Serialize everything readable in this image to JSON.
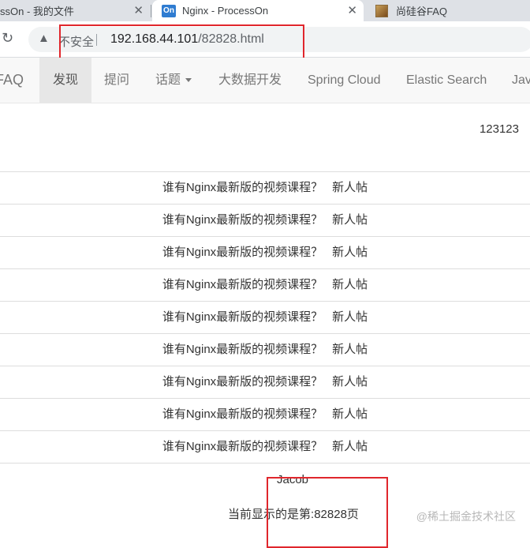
{
  "tabs": [
    {
      "title": "ssOn - 我的文件"
    },
    {
      "title": "Nginx - ProcessOn",
      "favicon_text": "On"
    },
    {
      "title": "尚硅谷FAQ"
    }
  ],
  "tab_close_glyph": "✕",
  "address_bar": {
    "security_label": "不安全",
    "url_host": "192.168.44.101",
    "url_path": "/82828.html"
  },
  "nav": {
    "brand": "FAQ",
    "items": [
      {
        "label": "发现"
      },
      {
        "label": "提问"
      },
      {
        "label": "话题"
      },
      {
        "label": "大数据开发"
      },
      {
        "label": "Spring Cloud"
      },
      {
        "label": "Elastic Search"
      },
      {
        "label": "Jav"
      }
    ]
  },
  "user": "123123",
  "posts": [
    {
      "title": "谁有Nginx最新版的视频课程？",
      "tag": "新人帖"
    },
    {
      "title": "谁有Nginx最新版的视频课程？",
      "tag": "新人帖"
    },
    {
      "title": "谁有Nginx最新版的视频课程？",
      "tag": "新人帖"
    },
    {
      "title": "谁有Nginx最新版的视频课程？",
      "tag": "新人帖"
    },
    {
      "title": "谁有Nginx最新版的视频课程？",
      "tag": "新人帖"
    },
    {
      "title": "谁有Nginx最新版的视频课程？",
      "tag": "新人帖"
    },
    {
      "title": "谁有Nginx最新版的视频课程？",
      "tag": "新人帖"
    },
    {
      "title": "谁有Nginx最新版的视频课程？",
      "tag": "新人帖"
    },
    {
      "title": "谁有Nginx最新版的视频课程？",
      "tag": "新人帖"
    }
  ],
  "author": "Jacob",
  "page_info": "当前显示的是第:82828页",
  "watermark": "@稀土掘金技术社区",
  "colors": {
    "highlight_box": "#e0262c",
    "nav_bg": "#f8f8f8",
    "active_nav_bg": "#e7e7e7"
  }
}
